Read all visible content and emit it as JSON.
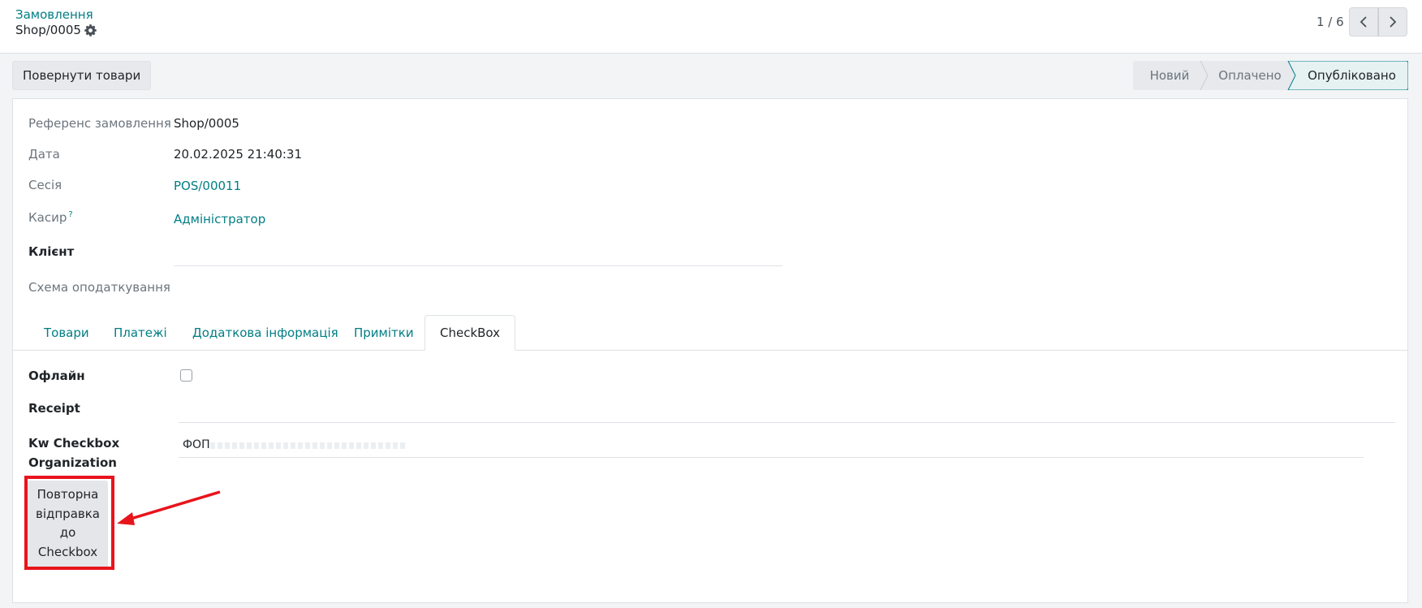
{
  "breadcrumb": {
    "parent": "Замовлення",
    "current": "Shop/0005"
  },
  "pager": {
    "value": "1 / 6"
  },
  "header": {
    "return_button": "Повернути товари",
    "statusbar": [
      "Новий",
      "Оплачено",
      "Опубліковано"
    ],
    "active_status": "Опубліковано"
  },
  "fields": {
    "order_ref": {
      "label": "Референс замовлення",
      "value": "Shop/0005"
    },
    "date": {
      "label": "Дата",
      "value": "20.02.2025 21:40:31"
    },
    "session": {
      "label": "Сесія",
      "value": "POS/00011"
    },
    "cashier": {
      "label": "Касир",
      "help": "?",
      "value": "Адміністратор"
    },
    "client": {
      "label": "Клієнт",
      "value": ""
    },
    "tax_scheme": {
      "label": "Схема оподаткування",
      "value": ""
    }
  },
  "tabs": [
    "Товари",
    "Платежі",
    "Додаткова інформація",
    "Примітки",
    "CheckBox"
  ],
  "active_tab": "CheckBox",
  "checkbox_tab": {
    "offline": {
      "label": "Офлайн",
      "checked": false
    },
    "receipt": {
      "label": "Receipt",
      "value": ""
    },
    "organization": {
      "label_line1": "Kw Checkbox",
      "label_line2": "Organization",
      "value": "ФОП"
    },
    "resend_button": {
      "line1": "Повторна",
      "line2": "відправка",
      "line3": "до",
      "line4": "Checkbox"
    }
  },
  "colors": {
    "accent": "#017e84",
    "highlight": "#e8141c",
    "active_status_bg": "#e6f1f2"
  }
}
